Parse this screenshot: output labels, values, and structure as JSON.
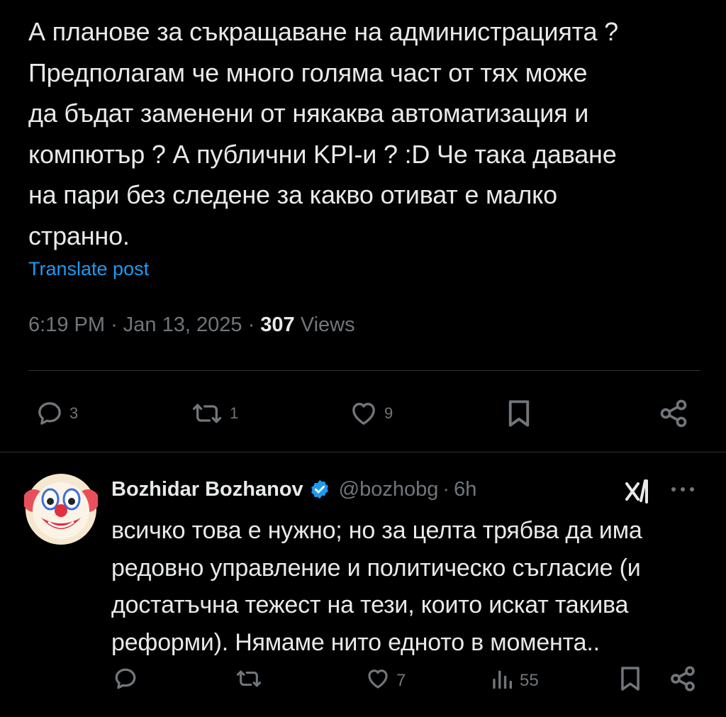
{
  "post": {
    "lines": [
      "А планове за съкращаване на администрацията ?",
      "Предполагам че много голяма част от тях може",
      "да бъдат заменени от някаква автоматизация и",
      "компютър ? А публични KPI-и ? :D Че така даване",
      "на пари без следене за какво отиват е малко",
      "странно."
    ],
    "translate_label": "Translate post",
    "time": "6:19 PM",
    "date": "Jan 13, 2025",
    "separator": "·",
    "views_count": "307",
    "views_label": "Views",
    "actions": {
      "replies": "3",
      "reposts": "1",
      "likes": "9"
    }
  },
  "reply": {
    "author_name": "Bozhidar Bozhanov",
    "handle": "@bozhobg",
    "separator": "·",
    "time": "6h",
    "lines": [
      "всичко това е нужно; но за целта трябва да има",
      "редовно управление и политическо съгласие (и",
      "достатъчна тежест на тези, които искат такива",
      "реформи). Нямаме нито едното в момента.."
    ],
    "actions": {
      "replies": "",
      "reposts": "",
      "likes": "7",
      "views": "55"
    }
  },
  "icons": {
    "reply": "speech-bubble-icon",
    "repost": "repost-arrows-icon",
    "like": "heart-icon",
    "bookmark": "bookmark-icon",
    "share": "share-icon",
    "views": "bar-chart-icon",
    "verified": "verified-badge-icon",
    "grok": "grok-icon",
    "more": "more-dots-icon",
    "avatar": "clown-face-avatar"
  },
  "colors": {
    "background": "#000000",
    "text": "#e7e9ea",
    "muted": "#71767b",
    "link": "#1d9bf0",
    "verified": "#1d9bf0",
    "divider": "#2f3336"
  }
}
